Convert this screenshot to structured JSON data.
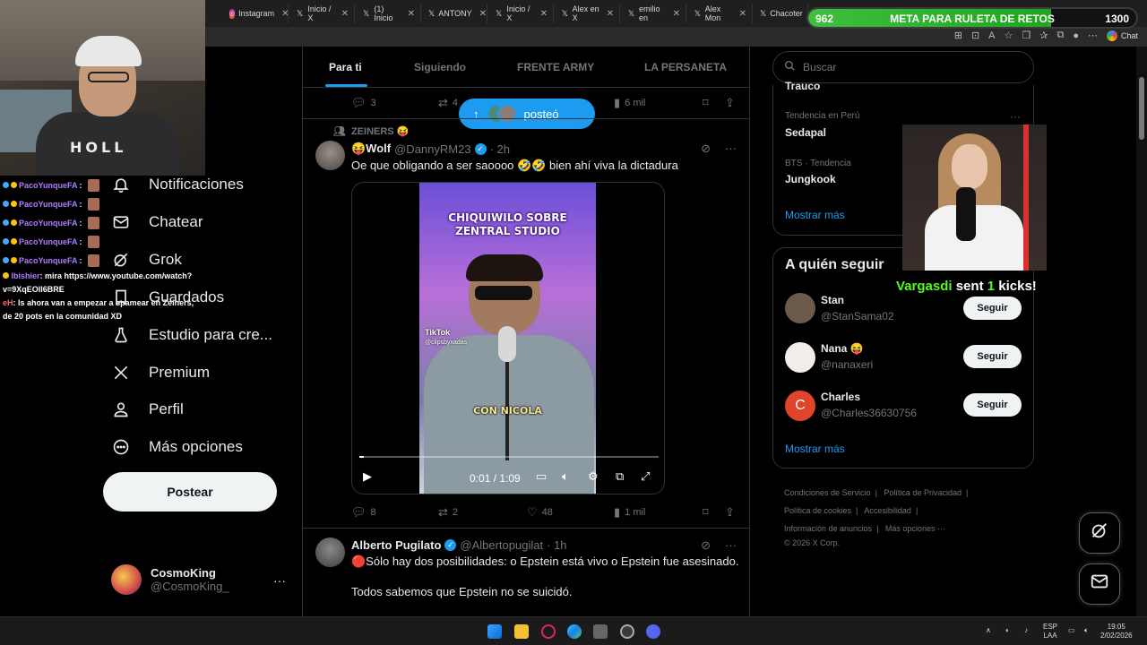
{
  "browser": {
    "tabs": [
      {
        "label": "Instagram",
        "icon": "instagram-icon"
      },
      {
        "label": "Inicio / X",
        "icon": "x-icon"
      },
      {
        "label": "(1) Inicio",
        "icon": "x-icon"
      },
      {
        "label": "ANTONY",
        "icon": "x-icon"
      },
      {
        "label": "Inicio / X",
        "icon": "x-icon"
      },
      {
        "label": "Alex en X",
        "icon": "x-icon"
      },
      {
        "label": "emilio en",
        "icon": "x-icon"
      },
      {
        "label": "Alex Mon",
        "icon": "x-icon"
      },
      {
        "label": "Chacoter",
        "icon": "x-icon"
      }
    ],
    "chat_label": "Chat"
  },
  "goal": {
    "current": "962",
    "label": "META PARA RULETA DE RETOS",
    "target": "1300",
    "progress_fraction": 0.74
  },
  "stream_chat": [
    {
      "user": "PacoYunqueFA",
      "sep": ":"
    },
    {
      "user": "PacoYunqueFA",
      "sep": ":"
    },
    {
      "user": "PacoYunqueFA",
      "sep": ":"
    },
    {
      "user": "PacoYunqueFA",
      "sep": ":"
    },
    {
      "user": "PacoYunqueFA",
      "sep": ":"
    }
  ],
  "stream_chat_multi": [
    {
      "user": "Ibishier",
      "text": ": mira https://www.youtube.com/watch?"
    },
    {
      "user": "",
      "text": "v=9XqEOlI6BRE"
    },
    {
      "user": "eH",
      "text": ": ls ahora van a empezar a spamear en Zeiners,"
    },
    {
      "user": "",
      "text": "de 20 pots en la comunidad XD"
    }
  ],
  "nav": {
    "items": [
      {
        "label": "Notificaciones",
        "icon": "bell-icon"
      },
      {
        "label": "Chatear",
        "icon": "mail-icon"
      },
      {
        "label": "Grok",
        "icon": "grok-icon"
      },
      {
        "label": "Guardados",
        "icon": "bookmark-icon"
      },
      {
        "label": "Estudio para cre...",
        "icon": "flask-icon"
      },
      {
        "label": "Premium",
        "icon": "x-logo-icon"
      },
      {
        "label": "Perfil",
        "icon": "person-icon"
      },
      {
        "label": "Más opciones",
        "icon": "more-circle-icon"
      }
    ],
    "post_button": "Postear",
    "profile": {
      "name": "CosmoKing",
      "handle": "@CosmoKing_",
      "more": "···"
    }
  },
  "feed": {
    "tabs": [
      "Para ti",
      "Siguiendo",
      "FRENTE ARMY",
      "LA PERSANETA"
    ],
    "active_tab": "Para ti",
    "posted_pill": "posteó",
    "prev_tweet_actions": {
      "replies": "3",
      "retweets": "4",
      "views": "6 mil"
    },
    "tweet1": {
      "community": "ZEINERS 😝",
      "name": "😝Wolf",
      "handle": "@DannyRM23",
      "time": "· 2h",
      "text": "Oe que obligando a ser saoooo 🤣🤣 bien ahí viva la dictadura",
      "video": {
        "title_line1": "CHIQUIWILO SOBRE",
        "title_line2": "ZENTRAL STUDIO",
        "watermark": "TikTok",
        "watermark_handle": "@clipsbyxadas",
        "caption": "CON NICOLA",
        "time": "0:01 / 1:09",
        "progress_fraction": 0.015
      },
      "actions": {
        "replies": "8",
        "retweets": "2",
        "likes": "48",
        "views": "1 mil"
      }
    },
    "tweet2": {
      "name": "Alberto Pugilato",
      "handle": "@Albertopugilat",
      "time": "· 1h",
      "line1": "🔴Sólo hay dos posibilidades: o Epstein está vivo o Epstein fue asesinado.",
      "line2": "Todos sabemos que Epstein no se suicidó."
    }
  },
  "right": {
    "search_placeholder": "Buscar",
    "trend_cut": "Trauco",
    "trends": [
      {
        "meta": "Tendencia en Perú",
        "name": "Sedapal"
      },
      {
        "meta": "BTS · Tendencia",
        "name": "Jungkook"
      }
    ],
    "show_more": "Mostrar más",
    "follow_title": "A quién seguir",
    "follow": [
      {
        "name": "Stan",
        "handle": "@StanSama02",
        "button": "Seguir",
        "avatar_color": "#6b5a4a"
      },
      {
        "name": "Nana 😝",
        "handle": "@nanaxeri",
        "button": "Seguir",
        "avatar_color": "#f1ede8"
      },
      {
        "name": "Charles",
        "handle": "@Charles36630756",
        "button": "Seguir",
        "avatar_color": "#e0452b",
        "initial": "C"
      }
    ],
    "follow_more": "Mostrar más",
    "footer": [
      "Condiciones de Servicio",
      "|",
      "Política de Privacidad",
      "|",
      "Política de cookies",
      "|",
      "Accesibilidad",
      "|",
      "Información de anuncios",
      "|",
      "Más opciones ···",
      "© 2026 X Corp."
    ]
  },
  "kick_alert": {
    "user": "Vargasdi",
    "mid": "sent",
    "count": "1",
    "end": "kicks!"
  },
  "taskbar": {
    "lang1": "ESP",
    "lang2": "LAA",
    "time": "19:05",
    "date": "2/02/2026"
  },
  "colors": {
    "accent": "#1d9bf0",
    "goal_green": "#3fbf3f",
    "kick_green": "#53fc18"
  }
}
